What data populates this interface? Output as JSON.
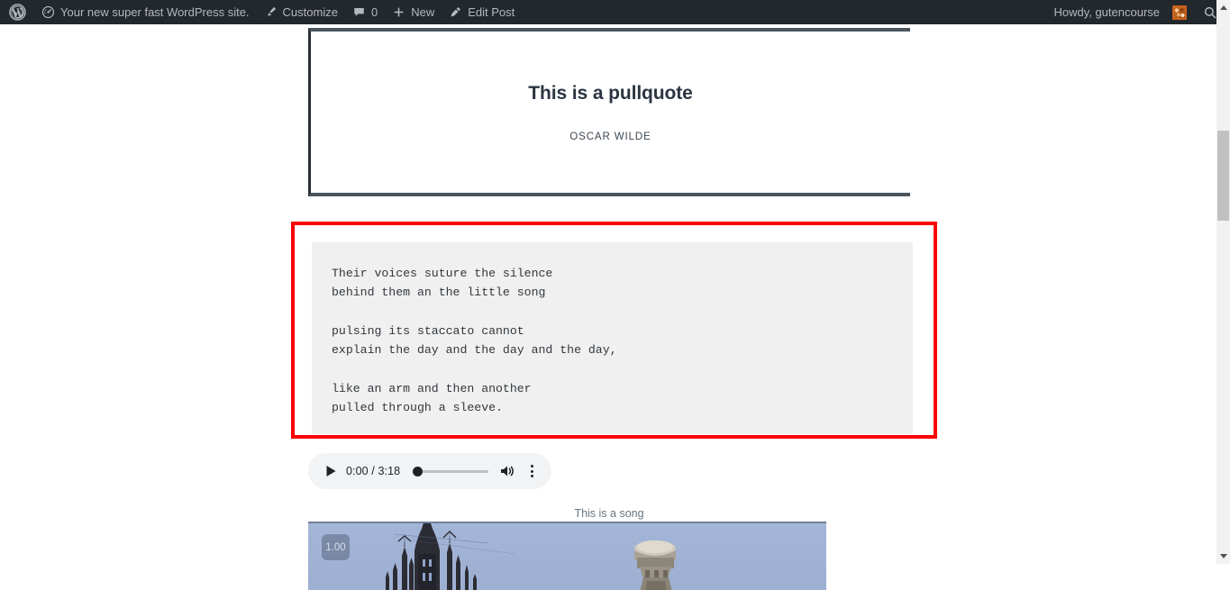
{
  "admin_bar": {
    "logo_icon": "wordpress-logo-icon",
    "site": {
      "label": "Your new super fast WordPress site.",
      "icon": "dashboard-speedometer-icon"
    },
    "customize": {
      "label": "Customize",
      "icon": "paintbrush-icon"
    },
    "comments": {
      "count": "0",
      "icon": "comment-bubble-icon"
    },
    "new": {
      "label": "New",
      "icon": "plus-icon"
    },
    "edit_post": {
      "label": "Edit Post",
      "icon": "pencil-icon"
    },
    "howdy": {
      "label": "Howdy, gutencourse",
      "avatar_icon": "user-avatar-icon"
    },
    "search": {
      "icon": "search-icon"
    },
    "bar_color": "#23282d",
    "text_color": "#b4b9be"
  },
  "content": {
    "pullquote": {
      "text": "This is a pullquote",
      "citation": "OSCAR WILDE",
      "border_color": "#4a555e"
    },
    "verse": {
      "text": "Their voices suture the silence\nbehind them an the little song\n\npulsing its staccato cannot\nexplain the day and the day and the day,\n\nlike an arm and then another\npulled through a sleeve.",
      "background": "#f0f0f0",
      "highlight_color": "#fa0000"
    },
    "audio": {
      "play_icon": "play-triangle-icon",
      "time": "0:00 / 3:18",
      "current_time": "0:00",
      "duration": "3:18",
      "progress_percent": 0,
      "volume_icon": "speaker-volume-icon",
      "menu_icon": "more-vertical-dots-icon",
      "caption": "This is a song"
    },
    "video": {
      "speed_badge": "1.00",
      "description": "Cathedral spire silhouette against blue sky",
      "sky_color": "#a2b4d6"
    }
  },
  "scrollbar": {
    "up_icon": "scroll-up-arrow-icon",
    "down_icon": "scroll-down-arrow-icon",
    "thumb_color": "#c1c1c1",
    "track_color": "#f1f1f1"
  }
}
